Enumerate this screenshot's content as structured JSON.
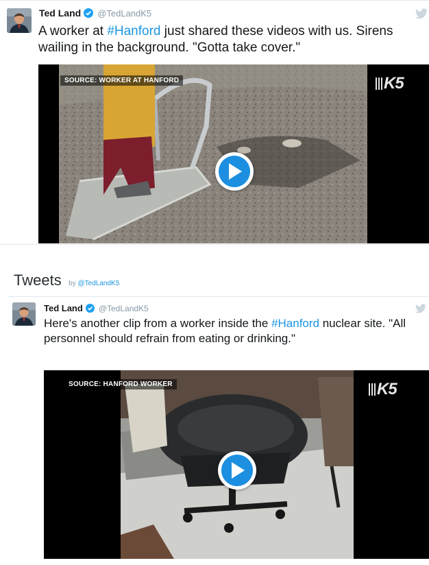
{
  "tweets": [
    {
      "author": "Ted Land",
      "handle": "@TedLandK5",
      "text_parts": [
        "A worker at ",
        "#Hanford",
        " just shared these videos with us. Sirens wailing in the background. \"Gotta take cover.\""
      ],
      "video": {
        "source_label": "SOURCE: WORKER AT HANFORD",
        "logo": "K5"
      }
    },
    {
      "author": "Ted Land",
      "handle": "@TedLandK5",
      "text_parts": [
        "Here's another clip from a worker inside the ",
        "#Hanford",
        " nuclear site. \"All personnel should refrain from eating or drinking.\""
      ],
      "video": {
        "source_label": "SOURCE: HANFORD WORKER",
        "logo": "K5"
      }
    }
  ],
  "timeline": {
    "title": "Tweets",
    "by_prefix": "by",
    "by_handle": "@TedLandK5"
  },
  "icons": {
    "verified": "verified-badge-icon",
    "twitter": "twitter-bird-icon",
    "play": "play-icon"
  },
  "colors": {
    "link": "#1b95e0",
    "verified": "#1da1f2",
    "play": "#1d8fe1",
    "muted": "#8899a6"
  }
}
